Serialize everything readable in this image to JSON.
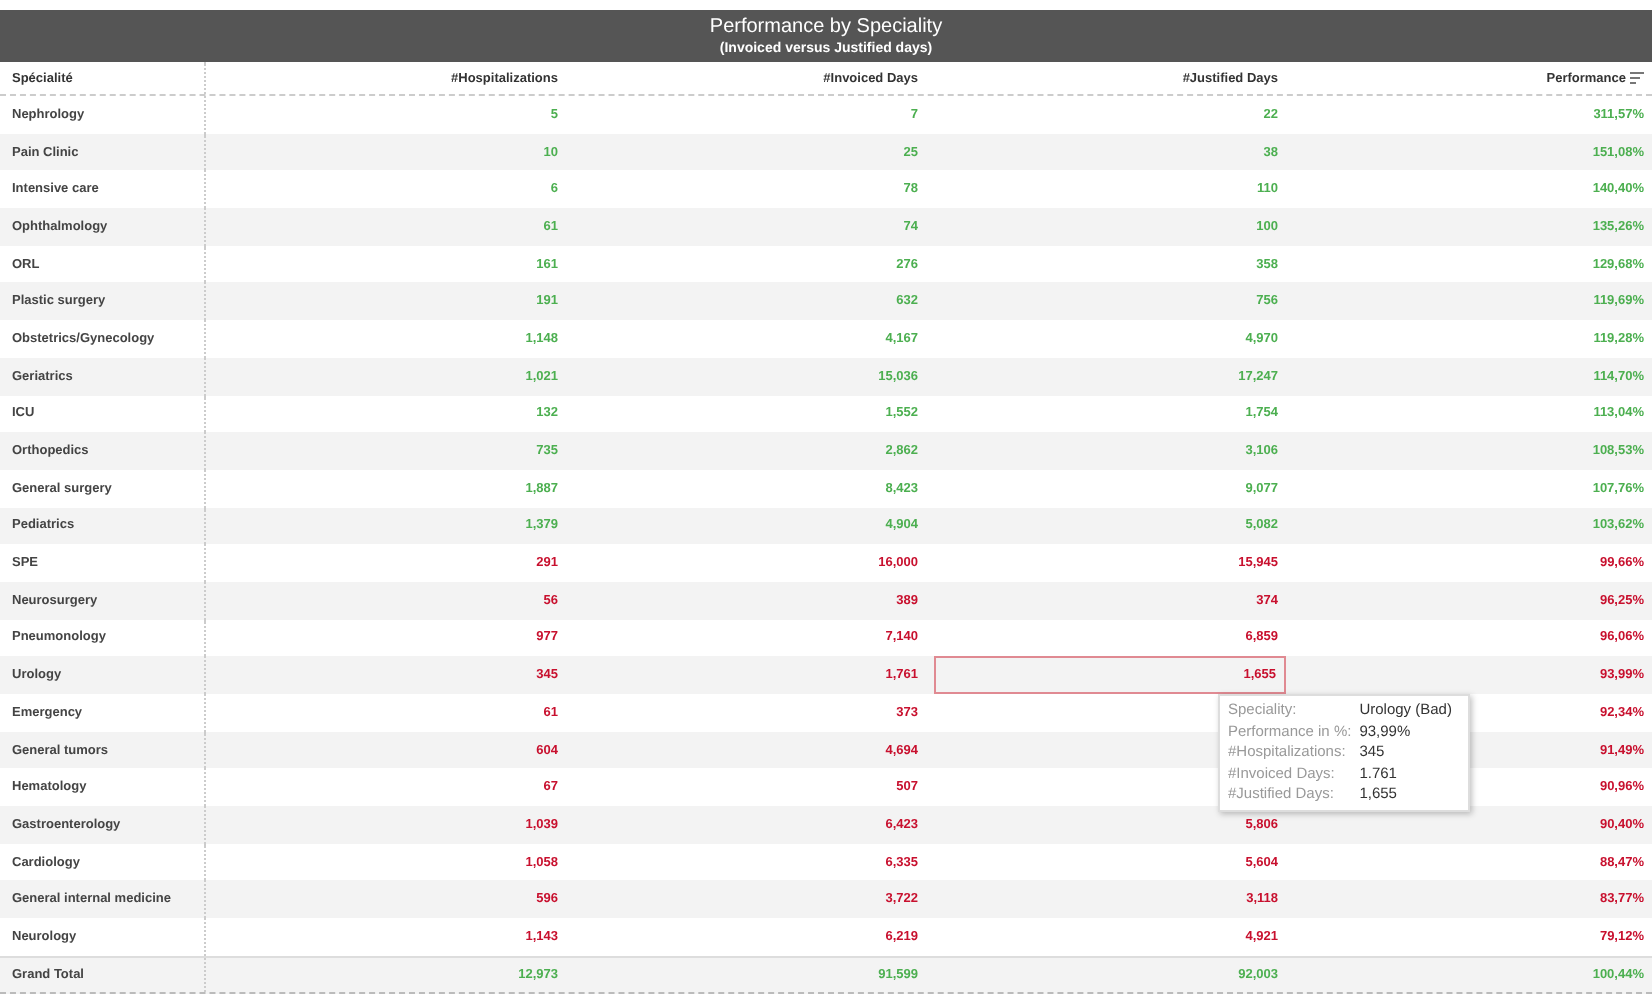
{
  "title": "Performance by Speciality",
  "subtitle": "(Invoiced versus Justified days)",
  "columns": [
    {
      "label": "Spécialité"
    },
    {
      "label": "#Hospitalizations"
    },
    {
      "label": "#Invoiced Days"
    },
    {
      "label": "#Justified Days"
    },
    {
      "label": "Performance",
      "sorted": true
    }
  ],
  "rows": [
    {
      "name": "Nephrology",
      "hospitalizations": "5",
      "invoiced": "7",
      "justified": "22",
      "performance": "311,57%",
      "color": "#4caf50",
      "highlighted": false
    },
    {
      "name": "Pain Clinic",
      "hospitalizations": "10",
      "invoiced": "25",
      "justified": "38",
      "performance": "151,08%",
      "color": "#4caf50",
      "highlighted": false
    },
    {
      "name": "Intensive care",
      "hospitalizations": "6",
      "invoiced": "78",
      "justified": "110",
      "performance": "140,40%",
      "color": "#4caf50",
      "highlighted": false
    },
    {
      "name": "Ophthalmology",
      "hospitalizations": "61",
      "invoiced": "74",
      "justified": "100",
      "performance": "135,26%",
      "color": "#4caf50",
      "highlighted": false
    },
    {
      "name": "ORL",
      "hospitalizations": "161",
      "invoiced": "276",
      "justified": "358",
      "performance": "129,68%",
      "color": "#4caf50",
      "highlighted": false
    },
    {
      "name": "Plastic surgery",
      "hospitalizations": "191",
      "invoiced": "632",
      "justified": "756",
      "performance": "119,69%",
      "color": "#4caf50",
      "highlighted": false
    },
    {
      "name": "Obstetrics/Gynecology",
      "hospitalizations": "1,148",
      "invoiced": "4,167",
      "justified": "4,970",
      "performance": "119,28%",
      "color": "#4caf50",
      "highlighted": false
    },
    {
      "name": "Geriatrics",
      "hospitalizations": "1,021",
      "invoiced": "15,036",
      "justified": "17,247",
      "performance": "114,70%",
      "color": "#4caf50",
      "highlighted": false
    },
    {
      "name": "ICU",
      "hospitalizations": "132",
      "invoiced": "1,552",
      "justified": "1,754",
      "performance": "113,04%",
      "color": "#4caf50",
      "highlighted": false
    },
    {
      "name": "Orthopedics",
      "hospitalizations": "735",
      "invoiced": "2,862",
      "justified": "3,106",
      "performance": "108,53%",
      "color": "#4caf50",
      "highlighted": false
    },
    {
      "name": "General surgery",
      "hospitalizations": "1,887",
      "invoiced": "8,423",
      "justified": "9,077",
      "performance": "107,76%",
      "color": "#4caf50",
      "highlighted": false
    },
    {
      "name": "Pediatrics",
      "hospitalizations": "1,379",
      "invoiced": "4,904",
      "justified": "5,082",
      "performance": "103,62%",
      "color": "#4caf50",
      "highlighted": false
    },
    {
      "name": "SPE",
      "hospitalizations": "291",
      "invoiced": "16,000",
      "justified": "15,945",
      "performance": "99,66%",
      "color": "#c8102e",
      "highlighted": false
    },
    {
      "name": "Neurosurgery",
      "hospitalizations": "56",
      "invoiced": "389",
      "justified": "374",
      "performance": "96,25%",
      "color": "#c8102e",
      "highlighted": false
    },
    {
      "name": "Pneumonology",
      "hospitalizations": "977",
      "invoiced": "7,140",
      "justified": "6,859",
      "performance": "96,06%",
      "color": "#c8102e",
      "highlighted": false
    },
    {
      "name": "Urology",
      "hospitalizations": "345",
      "invoiced": "1,761",
      "justified": "1,655",
      "performance": "93,99%",
      "color": "#c8102e",
      "highlighted": true
    },
    {
      "name": "Emergency",
      "hospitalizations": "61",
      "invoiced": "373",
      "performance": "92,34%",
      "color": "#c8102e",
      "highlighted": false
    },
    {
      "name": "General tumors",
      "hospitalizations": "604",
      "invoiced": "4,694",
      "performance": "91,49%",
      "color": "#c8102e",
      "highlighted": false
    },
    {
      "name": "Hematology",
      "hospitalizations": "67",
      "invoiced": "507",
      "performance": "90,96%",
      "color": "#c8102e",
      "highlighted": false
    },
    {
      "name": "Gastroenterology",
      "hospitalizations": "1,039",
      "invoiced": "6,423",
      "justified": "5,806",
      "performance": "90,40%",
      "color": "#c8102e",
      "highlighted": false
    },
    {
      "name": "Cardiology",
      "hospitalizations": "1,058",
      "invoiced": "6,335",
      "justified": "5,604",
      "performance": "88,47%",
      "color": "#c8102e",
      "highlighted": false
    },
    {
      "name": "General internal medicine",
      "hospitalizations": "596",
      "invoiced": "3,722",
      "justified": "3,118",
      "performance": "83,77%",
      "color": "#c8102e",
      "highlighted": false
    },
    {
      "name": "Neurology",
      "hospitalizations": "1,143",
      "invoiced": "6,219",
      "justified": "4,921",
      "performance": "79,12%",
      "color": "#c8102e",
      "highlighted": false
    }
  ],
  "total": {
    "name": "Grand Total",
    "hospitalizations": "12,973",
    "invoiced": "91,599",
    "justified": "92,003",
    "performance": "100,44%",
    "color": "#4caf50"
  },
  "tooltip": [
    {
      "label": "Speciality:",
      "value": "Urology (Bad)"
    },
    {
      "label": "Performance in %:",
      "value": "93,99%"
    },
    {
      "label": "#Hospitalizations:",
      "value": "345"
    },
    {
      "label": "#Invoiced Days:",
      "value": "1.761"
    },
    {
      "label": "#Justified Days:",
      "value": "1,655"
    }
  ]
}
